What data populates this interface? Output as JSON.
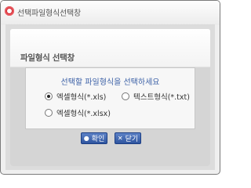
{
  "window": {
    "title": "선택파일형식선택창"
  },
  "panel": {
    "title": "파일형식 선택창",
    "instruction": "선택할 파일형식을 선택하세요",
    "options": [
      {
        "label": "엑셀형식(*.xls)",
        "selected": true
      },
      {
        "label": "텍스트형식(*.txt)",
        "selected": false
      },
      {
        "label": "엑셀형식(*.xlsx)",
        "selected": false
      }
    ]
  },
  "buttons": {
    "ok_label": "확인",
    "ok_icon": "circle-icon",
    "close_label": "닫기",
    "close_icon": "x-icon"
  },
  "colors": {
    "accent": "#d3262f",
    "instruction_text": "#3a5fa6",
    "button": "#3d63ad"
  }
}
